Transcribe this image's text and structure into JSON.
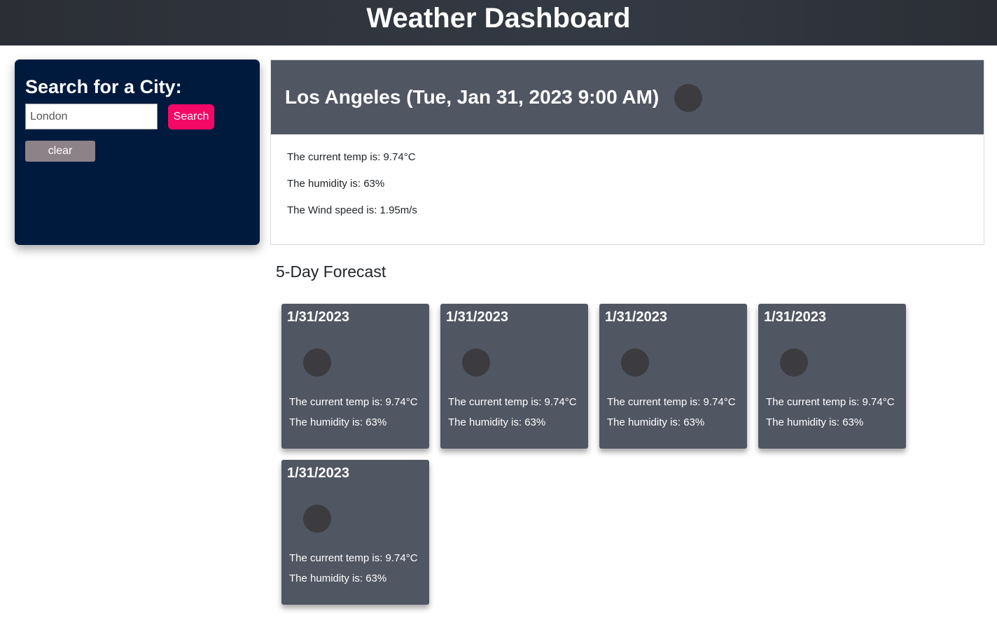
{
  "header": {
    "title": "Weather Dashboard"
  },
  "search": {
    "heading": "Search for a City:",
    "input_value": "London",
    "search_label": "Search",
    "clear_label": "clear"
  },
  "current": {
    "title": "Los Angeles (Tue, Jan 31, 2023 9:00 AM)",
    "temp": "The current temp is: 9.74°C",
    "humidity": "The humidity is: 63%",
    "wind": "The Wind speed is: 1.95m/s"
  },
  "forecast": {
    "title": "5-Day Forecast",
    "days": [
      {
        "date": "1/31/2023",
        "temp": "The current temp is: 9.74°C",
        "humidity": "The humidity is: 63%"
      },
      {
        "date": "1/31/2023",
        "temp": "The current temp is: 9.74°C",
        "humidity": "The humidity is: 63%"
      },
      {
        "date": "1/31/2023",
        "temp": "The current temp is: 9.74°C",
        "humidity": "The humidity is: 63%"
      },
      {
        "date": "1/31/2023",
        "temp": "The current temp is: 9.74°C",
        "humidity": "The humidity is: 63%"
      },
      {
        "date": "1/31/2023",
        "temp": "The current temp is: 9.74°C",
        "humidity": "The humidity is: 63%"
      }
    ]
  },
  "colors": {
    "header_bg": "#2f333b",
    "search_panel_bg": "#001a3d",
    "search_button_bg": "#f40866",
    "clear_button_bg": "#8d8288",
    "card_bg": "#515663",
    "icon_placeholder": "#3c3c40"
  },
  "icons": {
    "current_weather": "weather-icon",
    "forecast_weather": "weather-icon"
  }
}
